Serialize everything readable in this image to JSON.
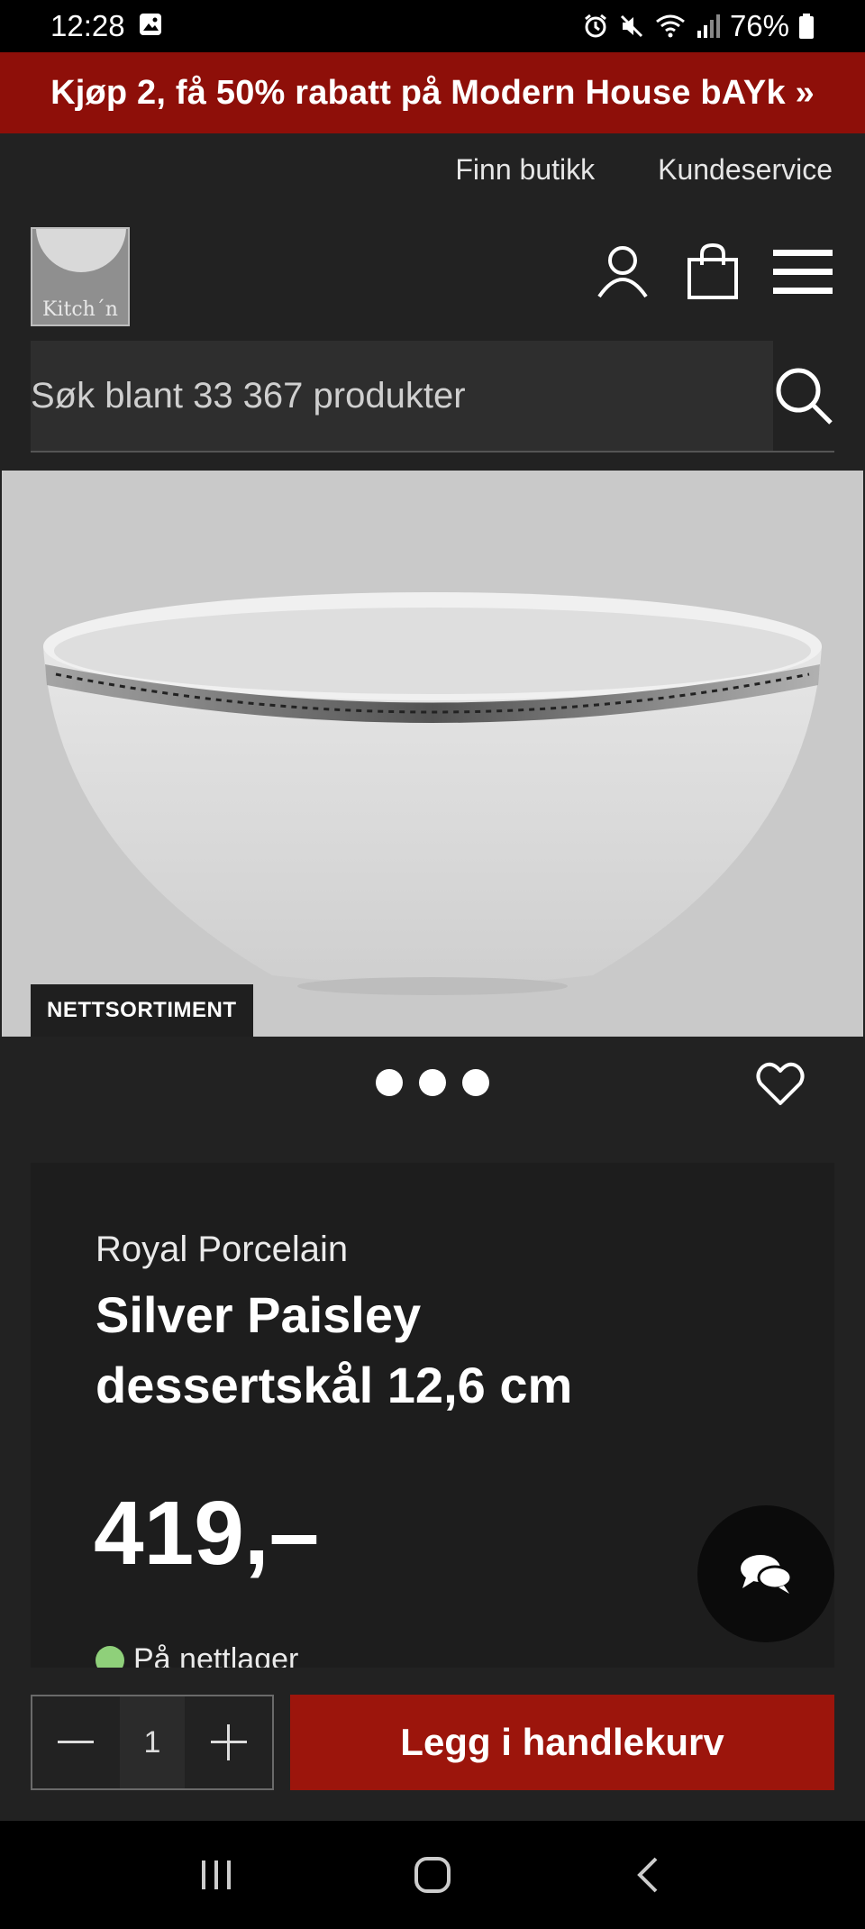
{
  "status": {
    "time": "12:28",
    "battery": "76%"
  },
  "promo": {
    "text": "Kjøp 2, få 50% rabatt på Modern House bAYk »"
  },
  "toplinks": {
    "store": "Finn butikk",
    "service": "Kundeservice"
  },
  "logo": {
    "text": "Kitch´n"
  },
  "search": {
    "placeholder": "Søk blant 33 367 produkter"
  },
  "image": {
    "badge": "NETTSORTIMENT",
    "dot_count": 3
  },
  "product": {
    "brand": "Royal Porcelain",
    "title": "Silver Paisley dessertskål 12,6 cm",
    "price": "419,–",
    "stock": "På nettlager"
  },
  "buy": {
    "quantity": "1",
    "add_label": "Legg i handlekurv"
  },
  "colors": {
    "promo": "#8e0f09",
    "add_button": "#9c150c",
    "background": "#222222",
    "stock_ok": "#8fd07a"
  },
  "icons": [
    "gallery-icon",
    "alarm-icon",
    "mute-icon",
    "wifi-icon",
    "signal-icon",
    "battery-icon",
    "user-icon",
    "cart-icon",
    "menu-icon",
    "search-icon",
    "heart-icon",
    "chat-icon",
    "minus-icon",
    "plus-icon",
    "recent-apps-icon",
    "home-icon",
    "back-icon"
  ]
}
